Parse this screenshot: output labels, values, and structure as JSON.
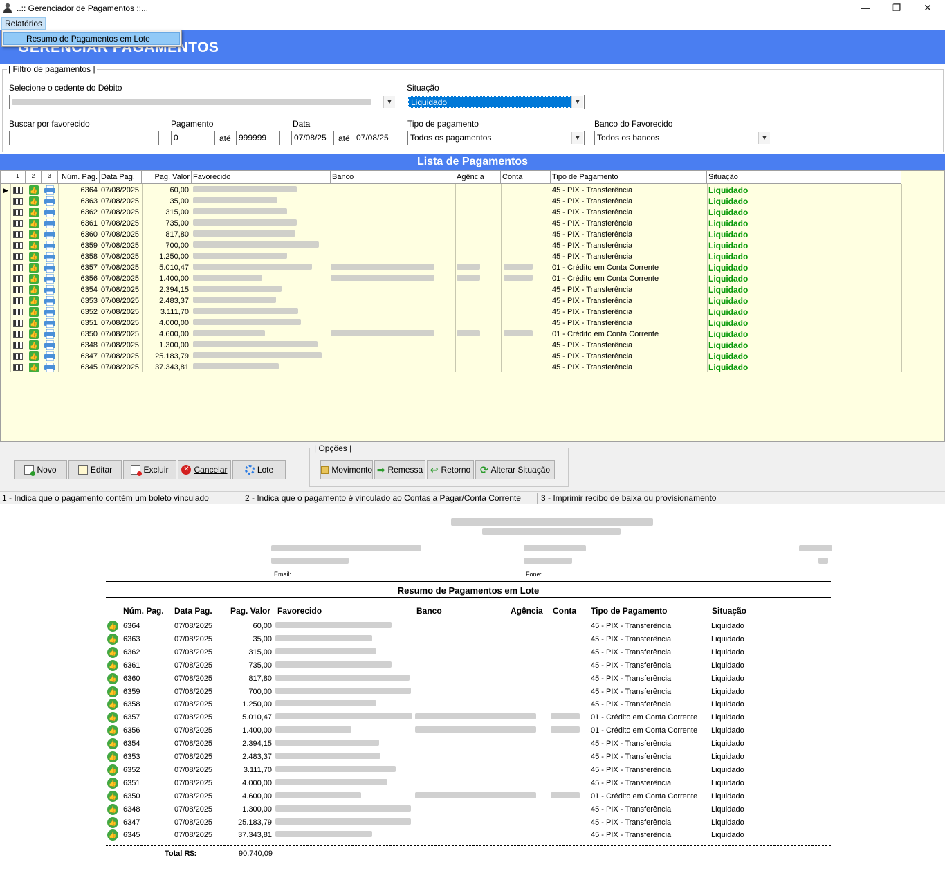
{
  "window": {
    "title": "..:: Gerenciador de Pagamentos ::...",
    "minimize": "—",
    "restore": "❐",
    "close": "✕"
  },
  "menu": {
    "relatorios": "Relatórios",
    "popup_item": "Resumo de Pagamentos em Lote"
  },
  "banner": {
    "title": "GERENCIAR PAGAMENTOS"
  },
  "filter": {
    "legend": "| Filtro de pagamentos |",
    "cedente_label": "Selecione o cedente do Débito",
    "situacao_label": "Situação",
    "situacao_value": "Liquidado",
    "buscar_label": "Buscar por favorecido",
    "buscar_value": "",
    "pagamento_label": "Pagamento",
    "pagamento_from": "0",
    "ate1": "até",
    "pagamento_to": "999999",
    "data_label": "Data",
    "data_from": "07/08/25",
    "ate2": "até",
    "data_to": "07/08/25",
    "tipo_label": "Tipo de pagamento",
    "tipo_value": "Todos os pagamentos",
    "banco_label": "Banco do Favorecido",
    "banco_value": "Todos os bancos"
  },
  "list": {
    "title": "Lista de Pagamentos",
    "columns": {
      "c1": "1",
      "c2": "2",
      "c3": "3",
      "num": "Núm. Pag.",
      "data": "Data Pag.",
      "valor": "Pag. Valor",
      "favorecido": "Favorecido",
      "banco": "Banco",
      "agencia": "Agência",
      "conta": "Conta",
      "tipo": "Tipo de Pagamento",
      "situacao": "Situação"
    },
    "rows": [
      {
        "num": "6364",
        "data": "07/08/2025",
        "valor": "60,00",
        "tipo": "45 - PIX - Transferência",
        "situacao": "Liquidado"
      },
      {
        "num": "6363",
        "data": "07/08/2025",
        "valor": "35,00",
        "tipo": "45 - PIX - Transferência",
        "situacao": "Liquidado"
      },
      {
        "num": "6362",
        "data": "07/08/2025",
        "valor": "315,00",
        "tipo": "45 - PIX - Transferência",
        "situacao": "Liquidado"
      },
      {
        "num": "6361",
        "data": "07/08/2025",
        "valor": "735,00",
        "tipo": "45 - PIX - Transferência",
        "situacao": "Liquidado"
      },
      {
        "num": "6360",
        "data": "07/08/2025",
        "valor": "817,80",
        "tipo": "45 - PIX - Transferência",
        "situacao": "Liquidado"
      },
      {
        "num": "6359",
        "data": "07/08/2025",
        "valor": "700,00",
        "tipo": "45 - PIX - Transferência",
        "situacao": "Liquidado"
      },
      {
        "num": "6358",
        "data": "07/08/2025",
        "valor": "1.250,00",
        "tipo": "45 - PIX - Transferência",
        "situacao": "Liquidado"
      },
      {
        "num": "6357",
        "data": "07/08/2025",
        "valor": "5.010,47",
        "tipo": "01 - Crédito em Conta Corrente",
        "situacao": "Liquidado"
      },
      {
        "num": "6356",
        "data": "07/08/2025",
        "valor": "1.400,00",
        "tipo": "01 - Crédito em Conta Corrente",
        "situacao": "Liquidado"
      },
      {
        "num": "6354",
        "data": "07/08/2025",
        "valor": "2.394,15",
        "tipo": "45 - PIX - Transferência",
        "situacao": "Liquidado"
      },
      {
        "num": "6353",
        "data": "07/08/2025",
        "valor": "2.483,37",
        "tipo": "45 - PIX - Transferência",
        "situacao": "Liquidado"
      },
      {
        "num": "6352",
        "data": "07/08/2025",
        "valor": "3.111,70",
        "tipo": "45 - PIX - Transferência",
        "situacao": "Liquidado"
      },
      {
        "num": "6351",
        "data": "07/08/2025",
        "valor": "4.000,00",
        "tipo": "45 - PIX - Transferência",
        "situacao": "Liquidado"
      },
      {
        "num": "6350",
        "data": "07/08/2025",
        "valor": "4.600,00",
        "tipo": "01 - Crédito em Conta Corrente",
        "situacao": "Liquidado"
      },
      {
        "num": "6348",
        "data": "07/08/2025",
        "valor": "1.300,00",
        "tipo": "45 - PIX - Transferência",
        "situacao": "Liquidado"
      },
      {
        "num": "6347",
        "data": "07/08/2025",
        "valor": "25.183,79",
        "tipo": "45 - PIX - Transferência",
        "situacao": "Liquidado"
      },
      {
        "num": "6345",
        "data": "07/08/2025",
        "valor": "37.343,81",
        "tipo": "45 - PIX - Transferência",
        "situacao": "Liquidado"
      }
    ]
  },
  "buttons": {
    "novo": "Novo",
    "editar": "Editar",
    "excluir": "Excluir",
    "cancelar": "Cancelar",
    "lote": "Lote",
    "opcoes_legend": "| Opções |",
    "movimento": "Movimento",
    "remessa": "Remessa",
    "retorno": "Retorno",
    "alterar": "Alterar Situação"
  },
  "status": {
    "s1": "1 - Indica que o pagamento contém um boleto vinculado",
    "s2": "2 - Indica que o pagamento é vinculado ao Contas a Pagar/Conta Corrente",
    "s3": "3 - Imprimir recibo de baixa ou provisionamento"
  },
  "report": {
    "email_label": "Email:",
    "fone_label": "Fone:",
    "title": "Resumo de Pagamentos em Lote",
    "columns": {
      "num": "Núm. Pag.",
      "data": "Data Pag.",
      "valor": "Pag. Valor",
      "favorecido": "Favorecido",
      "banco": "Banco",
      "agencia": "Agência",
      "conta": "Conta",
      "tipo": "Tipo de Pagamento",
      "situacao": "Situação"
    },
    "total_label": "Total R$:",
    "total_value": "90.740,09"
  },
  "colors": {
    "accent": "#4a7ef1",
    "grid_bg": "#ffffe1",
    "ok_green": "#0a9b0a"
  }
}
